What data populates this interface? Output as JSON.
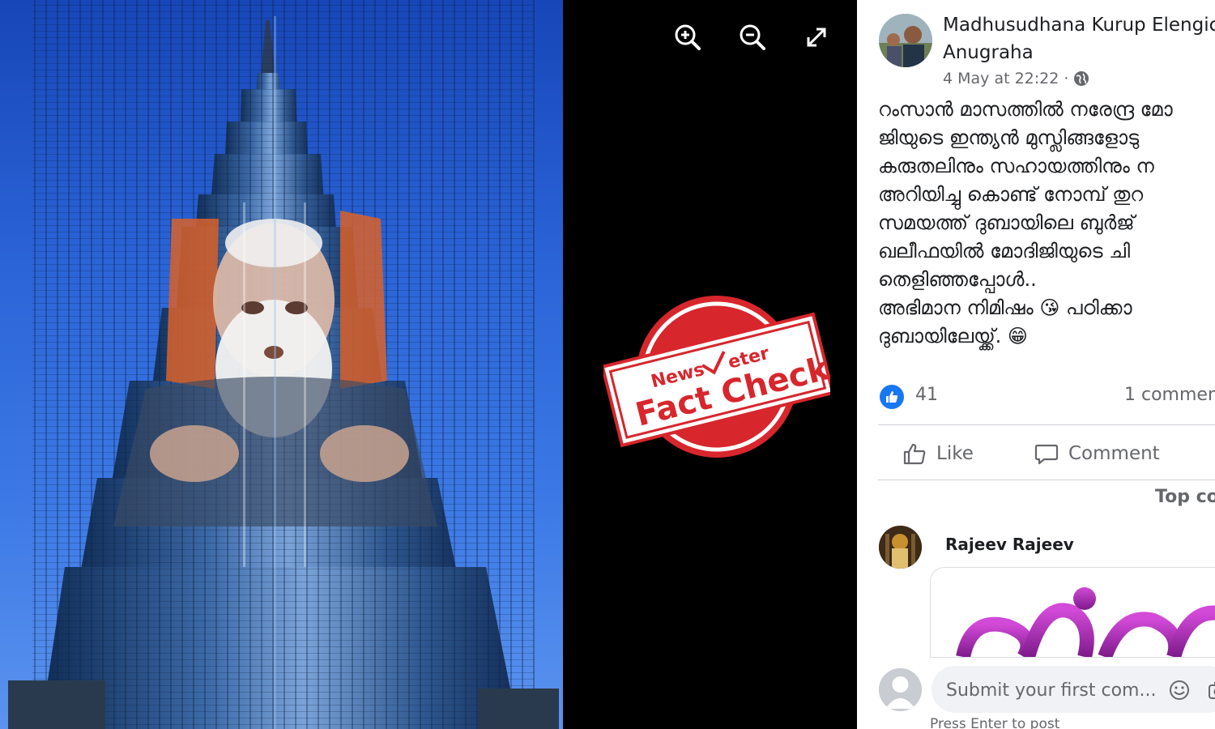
{
  "viewer": {
    "zoom_in_icon": "zoom-in-icon",
    "zoom_out_icon": "zoom-out-icon",
    "fullscreen_icon": "expand-icon"
  },
  "stamp": {
    "brand_left": "News",
    "brand_right": "eter",
    "title": "Fact Check",
    "color": "#d7262c"
  },
  "post": {
    "author_line1": "Madhusudhana Kurup Elengic",
    "author_line2": "Anugraha",
    "timestamp": "4 May at 22:22",
    "separator": "·",
    "audience_icon": "globe-icon",
    "text_lines": [
      "റംസാൻ മാസത്തിൽ നരേന്ദ്ര മോ",
      "ജിയുടെ ഇന്ത്യൻ മുസ്ലിങ്ങളോടു",
      "കരുതലിനും സഹായത്തിനും ന",
      "അറിയിച്ചു കൊണ്ട് നോമ്പ് തുറ",
      "സമയത്ത് ദുബായിലെ ബുർജ്",
      "ഖലീഫയിൽ മോദിജിയുടെ ചി",
      "തെളിഞ്ഞപ്പോൾ..",
      "അഭിമാന നിമിഷം 😘 പഠിക്കാ",
      "ദുബായിലേയ്ക്ക്. 😁"
    ]
  },
  "reactions": {
    "like_count": "41",
    "comments": "1 commen"
  },
  "actions": {
    "like_label": "Like",
    "comment_label": "Comment"
  },
  "comments_section": {
    "sort_label": "Top co",
    "commenter_name": "Rajeev Rajeev",
    "composer_placeholder": "Submit your first com...",
    "hint": "Press Enter to post"
  },
  "colors": {
    "facebook_blue": "#1877f2",
    "text_secondary": "#65676b"
  }
}
